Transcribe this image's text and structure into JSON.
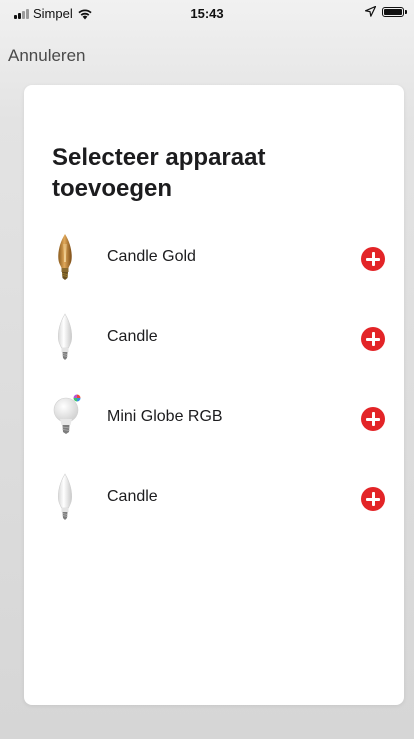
{
  "status_bar": {
    "carrier": "Simpel",
    "time": "15:43",
    "icons": [
      "signal-icon",
      "wifi-icon",
      "location-arrow-icon",
      "battery-icon"
    ]
  },
  "nav": {
    "cancel_label": "Annuleren"
  },
  "card": {
    "title": "Selecteer apparaat toevoegen",
    "devices": [
      {
        "name": "Candle Gold",
        "icon": "candle-gold-bulb-icon"
      },
      {
        "name": "Candle",
        "icon": "candle-bulb-icon"
      },
      {
        "name": "Mini Globe RGB",
        "icon": "mini-globe-rgb-bulb-icon"
      },
      {
        "name": "Candle",
        "icon": "candle-bulb-icon"
      }
    ],
    "add_icon": "plus-circle-icon"
  },
  "colors": {
    "accent": "#e32427",
    "card_background": "#ffffff",
    "screen_background": "#dcdcdc"
  }
}
